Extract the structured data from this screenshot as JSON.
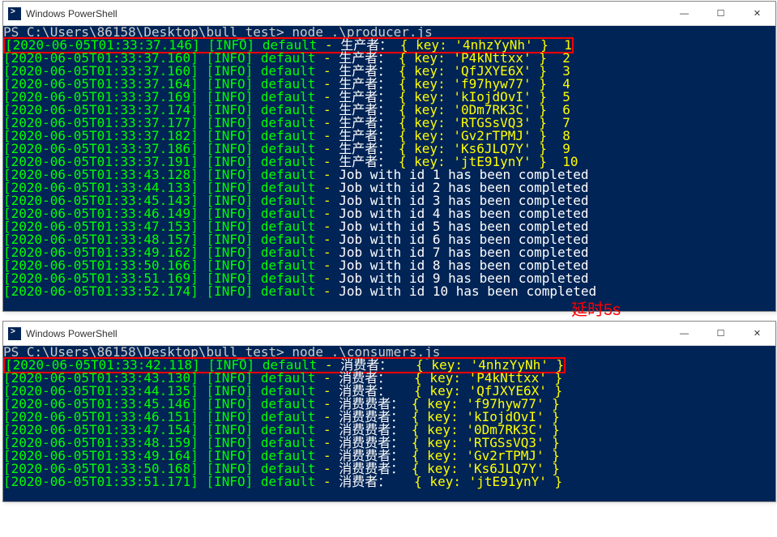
{
  "window1": {
    "title": "Windows PowerShell",
    "prompt": "PS C:\\Users\\86158\\Desktop\\bull_test>",
    "command": "node .\\producer.js",
    "lines": [
      {
        "ts": "[2020-06-05T01:33:37.146]",
        "lvl": "[INFO]",
        "def": "default",
        "role": "生产者：",
        "body": "{ key: '4nhzYyNh' }",
        "num": " 1",
        "hl": true
      },
      {
        "ts": "[2020-06-05T01:33:37.160]",
        "lvl": "[INFO]",
        "def": "default",
        "role": "生产者：",
        "body": "{ key: 'P4kNttxx' }",
        "num": " 2"
      },
      {
        "ts": "[2020-06-05T01:33:37.160]",
        "lvl": "[INFO]",
        "def": "default",
        "role": "生产者：",
        "body": "{ key: 'QfJXYE6X' }",
        "num": " 3"
      },
      {
        "ts": "[2020-06-05T01:33:37.164]",
        "lvl": "[INFO]",
        "def": "default",
        "role": "生产者：",
        "body": "{ key: 'f97hyw77' }",
        "num": " 4"
      },
      {
        "ts": "[2020-06-05T01:33:37.169]",
        "lvl": "[INFO]",
        "def": "default",
        "role": "生产者：",
        "body": "{ key: 'kIojdOvI' }",
        "num": " 5"
      },
      {
        "ts": "[2020-06-05T01:33:37.174]",
        "lvl": "[INFO]",
        "def": "default",
        "role": "生产者：",
        "body": "{ key: '0Dm7RK3C' }",
        "num": " 6"
      },
      {
        "ts": "[2020-06-05T01:33:37.177]",
        "lvl": "[INFO]",
        "def": "default",
        "role": "生产者：",
        "body": "{ key: 'RTGSsVQ3' }",
        "num": " 7"
      },
      {
        "ts": "[2020-06-05T01:33:37.182]",
        "lvl": "[INFO]",
        "def": "default",
        "role": "生产者：",
        "body": "{ key: 'Gv2rTPMJ' }",
        "num": " 8"
      },
      {
        "ts": "[2020-06-05T01:33:37.186]",
        "lvl": "[INFO]",
        "def": "default",
        "role": "生产者：",
        "body": "{ key: 'Ks6JLQ7Y' }",
        "num": " 9"
      },
      {
        "ts": "[2020-06-05T01:33:37.191]",
        "lvl": "[INFO]",
        "def": "default",
        "role": "生产者：",
        "body": "{ key: 'jtE91ynY' }",
        "num": " 10"
      },
      {
        "ts": "[2020-06-05T01:33:43.128]",
        "lvl": "[INFO]",
        "def": "default",
        "msg": "Job with id 1 has been completed"
      },
      {
        "ts": "[2020-06-05T01:33:44.133]",
        "lvl": "[INFO]",
        "def": "default",
        "msg": "Job with id 2 has been completed"
      },
      {
        "ts": "[2020-06-05T01:33:45.143]",
        "lvl": "[INFO]",
        "def": "default",
        "msg": "Job with id 3 has been completed"
      },
      {
        "ts": "[2020-06-05T01:33:46.149]",
        "lvl": "[INFO]",
        "def": "default",
        "msg": "Job with id 4 has been completed"
      },
      {
        "ts": "[2020-06-05T01:33:47.153]",
        "lvl": "[INFO]",
        "def": "default",
        "msg": "Job with id 5 has been completed"
      },
      {
        "ts": "[2020-06-05T01:33:48.157]",
        "lvl": "[INFO]",
        "def": "default",
        "msg": "Job with id 6 has been completed"
      },
      {
        "ts": "[2020-06-05T01:33:49.162]",
        "lvl": "[INFO]",
        "def": "default",
        "msg": "Job with id 7 has been completed"
      },
      {
        "ts": "[2020-06-05T01:33:50.166]",
        "lvl": "[INFO]",
        "def": "default",
        "msg": "Job with id 8 has been completed"
      },
      {
        "ts": "[2020-06-05T01:33:51.169]",
        "lvl": "[INFO]",
        "def": "default",
        "msg": "Job with id 9 has been completed"
      },
      {
        "ts": "[2020-06-05T01:33:52.174]",
        "lvl": "[INFO]",
        "def": "default",
        "msg": "Job with id 10 has been completed"
      }
    ]
  },
  "window2": {
    "title": "Windows PowerShell",
    "prompt": "PS C:\\Users\\86158\\Desktop\\bull_test>",
    "command": "node .\\consumers.js",
    "lines": [
      {
        "ts": "[2020-06-05T01:33:42.118]",
        "lvl": "[INFO]",
        "def": "default",
        "role": "消费者：",
        "extra": "  ",
        "body": "{ key: '4nhzYyNh' }",
        "hl": true
      },
      {
        "ts": "[2020-06-05T01:33:43.130]",
        "lvl": "[INFO]",
        "def": "default",
        "role": "消费者：",
        "extra": "  ",
        "body": "{ key: 'P4kNttxx' }"
      },
      {
        "ts": "[2020-06-05T01:33:44.135]",
        "lvl": "[INFO]",
        "def": "default",
        "role": "消费者：",
        "extra": "  ",
        "body": "{ key: 'QfJXYE6X' }"
      },
      {
        "ts": "[2020-06-05T01:33:45.146]",
        "lvl": "[INFO]",
        "def": "default",
        "role": "消费费者：",
        "extra": "",
        "body": "{ key: 'f97hyw77' }"
      },
      {
        "ts": "[2020-06-05T01:33:46.151]",
        "lvl": "[INFO]",
        "def": "default",
        "role": "消费费者：",
        "extra": "",
        "body": "{ key: 'kIojdOvI' }"
      },
      {
        "ts": "[2020-06-05T01:33:47.154]",
        "lvl": "[INFO]",
        "def": "default",
        "role": "消费费者：",
        "extra": "",
        "body": "{ key: '0Dm7RK3C' }"
      },
      {
        "ts": "[2020-06-05T01:33:48.159]",
        "lvl": "[INFO]",
        "def": "default",
        "role": "消费费者：",
        "extra": "",
        "body": "{ key: 'RTGSsVQ3' }"
      },
      {
        "ts": "[2020-06-05T01:33:49.164]",
        "lvl": "[INFO]",
        "def": "default",
        "role": "消费费者：",
        "extra": "",
        "body": "{ key: 'Gv2rTPMJ' }"
      },
      {
        "ts": "[2020-06-05T01:33:50.168]",
        "lvl": "[INFO]",
        "def": "default",
        "role": "消费费者：",
        "extra": "",
        "body": "{ key: 'Ks6JLQ7Y' }"
      },
      {
        "ts": "[2020-06-05T01:33:51.171]",
        "lvl": "[INFO]",
        "def": "default",
        "role": "消费者：",
        "extra": "  ",
        "body": "{ key: 'jtE91ynY' }"
      }
    ]
  },
  "annotation": "延时5s",
  "controls": {
    "min": "—",
    "max": "☐",
    "close": "✕"
  }
}
